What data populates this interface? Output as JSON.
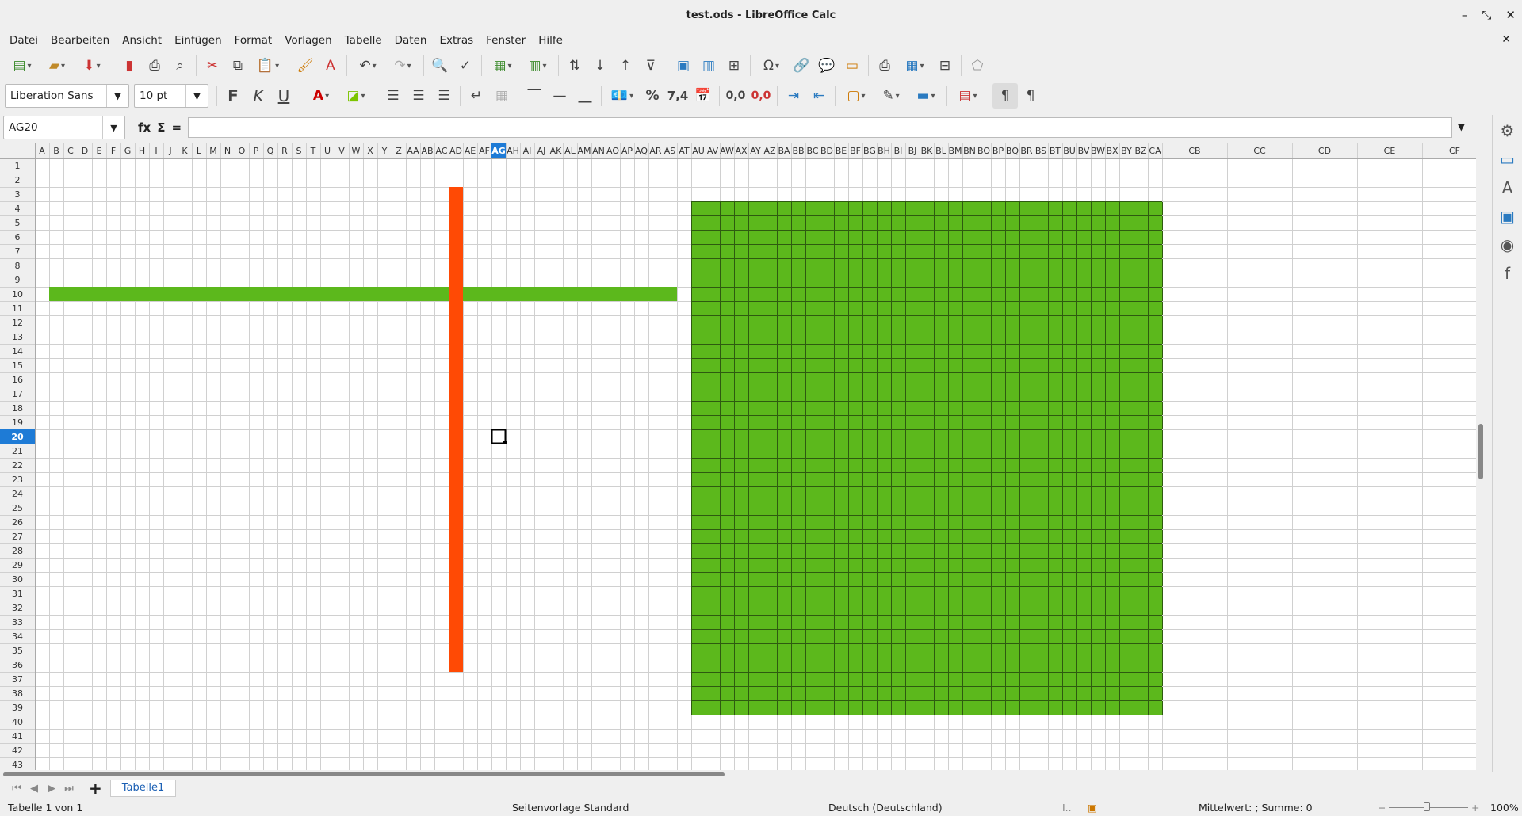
{
  "window": {
    "title": "test.ods - LibreOffice Calc",
    "minimize": "–",
    "restore": "⤡",
    "close": "✕"
  },
  "menu": [
    "Datei",
    "Bearbeiten",
    "Ansicht",
    "Einfügen",
    "Format",
    "Vorlagen",
    "Tabelle",
    "Daten",
    "Extras",
    "Fenster",
    "Hilfe"
  ],
  "toolbar": {
    "font_name": "Liberation Sans",
    "font_size": "10 pt",
    "bold": "F",
    "italic": "K",
    "underline": "U",
    "percent": "%",
    "number": "7,4",
    "add_decimal": "0,0",
    "del_decimal": "0,0"
  },
  "formula_bar": {
    "cell_ref": "AG20",
    "fx": "fx",
    "sum": "Σ",
    "eq": "=",
    "value": ""
  },
  "grid": {
    "columns": [
      "A",
      "B",
      "C",
      "D",
      "E",
      "F",
      "G",
      "H",
      "I",
      "J",
      "K",
      "L",
      "M",
      "N",
      "O",
      "P",
      "Q",
      "R",
      "S",
      "T",
      "U",
      "V",
      "W",
      "X",
      "Y",
      "Z",
      "AA",
      "AB",
      "AC",
      "AD",
      "AE",
      "AF",
      "AG",
      "AH",
      "AI",
      "AJ",
      "AK",
      "AL",
      "AM",
      "AN",
      "AO",
      "AP",
      "AQ",
      "AR",
      "AS",
      "AT",
      "AU",
      "AV",
      "AW",
      "AX",
      "AY",
      "AZ",
      "BA",
      "BB",
      "BC",
      "BD",
      "BE",
      "BF",
      "BG",
      "BH",
      "BI",
      "BJ",
      "BK",
      "BL",
      "BM",
      "BN",
      "BO",
      "BP",
      "BQ",
      "BR",
      "BS",
      "BT",
      "BU",
      "BV",
      "BW",
      "BX",
      "BY",
      "BZ",
      "CA",
      "CB",
      "CC",
      "CD",
      "CE",
      "CF"
    ],
    "row_count": 43,
    "active_cell": "AG20",
    "colors": {
      "green": "#5cb81c",
      "orange": "#ff4a05",
      "header_active": "#1e7bd6"
    }
  },
  "sheet_tabs": [
    "Tabelle1"
  ],
  "status": {
    "sheet": "Tabelle 1 von 1",
    "page_style": "Seitenvorlage Standard",
    "language": "Deutsch (Deutschland)",
    "summary": "Mittelwert: ; Summe: 0",
    "zoom": "100%"
  }
}
